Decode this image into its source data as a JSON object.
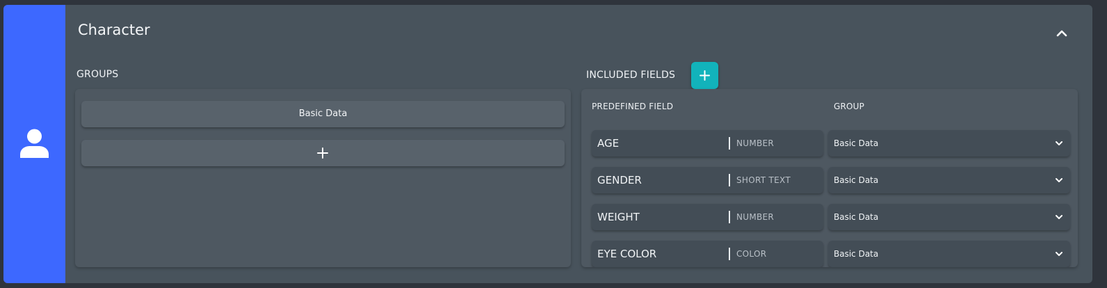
{
  "card": {
    "title": "Character",
    "icon": "user-icon",
    "collapse_icon": "chevron-up-icon"
  },
  "groups": {
    "heading": "GROUPS",
    "items": [
      {
        "label": "Basic Data"
      }
    ],
    "add_icon": "plus-icon"
  },
  "fields": {
    "heading": "INCLUDED FIELDS",
    "add_icon": "plus-icon",
    "columns": {
      "predefined": "PREDEFINED FIELD",
      "group": "GROUP"
    },
    "rows": [
      {
        "name": "AGE",
        "type": "NUMBER",
        "group": "Basic Data"
      },
      {
        "name": "GENDER",
        "type": "SHORT TEXT",
        "group": "Basic Data"
      },
      {
        "name": "WEIGHT",
        "type": "NUMBER",
        "group": "Basic Data"
      },
      {
        "name": "EYE COLOR",
        "type": "COLOR",
        "group": "Basic Data"
      }
    ]
  },
  "colors": {
    "accent": "#3d68ff",
    "add_button": "#12b3bb",
    "card_bg": "#48535c",
    "page_bg": "#2f343c"
  }
}
